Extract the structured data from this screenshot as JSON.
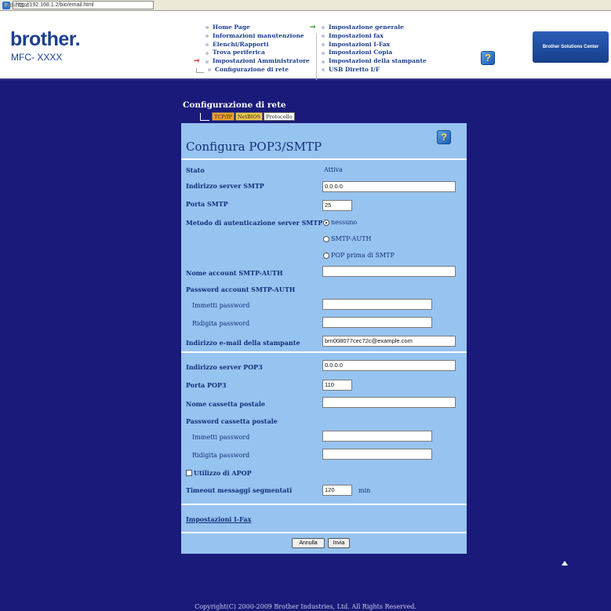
{
  "addressbar": {
    "label": "Indirizzo",
    "url": "http://192.168.1.2/bio/email.html"
  },
  "header": {
    "logo": "brother.",
    "model": "MFC- XXXX",
    "nav_left": [
      "Home Page",
      "Informazioni manutenzione",
      "Elenchi/Rapporti",
      "Trova periferica",
      "Impostazioni Amministratore",
      "Configurazione di rete"
    ],
    "nav_right": [
      "Impostazione generale",
      "Impostazioni fax",
      "Impostazioni I-Fax",
      "Impostazioni Copia",
      "Impostazioni della stampante",
      "USB Diretto I/F"
    ],
    "solutions": "Brother Solutions Center",
    "help_icon": "?"
  },
  "section": {
    "title": "Configurazione di rete",
    "tabs": [
      "TCP/IP",
      "NetBIOS",
      "Protocollo"
    ]
  },
  "panel": {
    "title": "Configura POP3/SMTP",
    "help_icon": "?",
    "status_label": "Stato",
    "status_value": "Attiva",
    "smtp_server_label": "Indirizzo server SMTP",
    "smtp_server_value": "0.0.0.0",
    "smtp_port_label": "Porta SMTP",
    "smtp_port_value": "25",
    "auth_label": "Metodo di autenticazione server SMTP",
    "auth_options": [
      "nessuno",
      "SMTP-AUTH",
      "POP prima di SMTP"
    ],
    "auth_selected": "nessuno",
    "smtp_account_label": "Nome account SMTP-AUTH",
    "smtp_account_value": "",
    "smtp_password_label": "Password account SMTP-AUTH",
    "enter_password_label": "Immetti password",
    "retype_password_label": "Ridigita password",
    "printer_email_label": "Indirizzo e-mail della stampante",
    "printer_email_value": "brn008077cec72c@example.com",
    "pop3_server_label": "Indirizzo server POP3",
    "pop3_server_value": "0.0.0.0",
    "pop3_port_label": "Porta POP3",
    "pop3_port_value": "110",
    "mailbox_label": "Nome cassetta postale",
    "mailbox_value": "",
    "mailbox_password_label": "Password cassetta postale",
    "enter_password2_label": "Immetti password",
    "retype_password2_label": "Ridigita password",
    "apop_label": "Utilizzo di APOP",
    "timeout_label": "Timeout messaggi segmentati",
    "timeout_value": "120",
    "timeout_unit": "min",
    "ifax_link": "Impostazioni I-Fax",
    "cancel_button": "Annulla",
    "submit_button": "Invia"
  },
  "footer": {
    "copyright": "Copyright(C) 2000-2009 Brother Industries, Ltd. All Rights Reserved."
  }
}
